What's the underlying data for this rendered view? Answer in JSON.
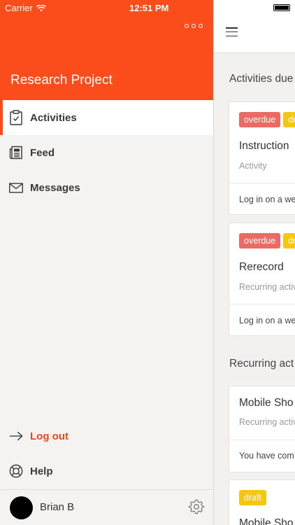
{
  "status_bar": {
    "carrier": "Carrier",
    "time": "12:51 PM"
  },
  "drawer": {
    "title": "Research Project",
    "nav": [
      {
        "label": "Activities",
        "icon": "clipboard-check-icon",
        "active": true
      },
      {
        "label": "Feed",
        "icon": "newspaper-icon",
        "active": false
      },
      {
        "label": "Messages",
        "icon": "envelope-icon",
        "active": false
      }
    ],
    "logout_label": "Log out",
    "help_label": "Help",
    "user_name": "Brian B"
  },
  "main": {
    "section_due": "Activities due",
    "section_recurring": "Recurring act",
    "cards": [
      {
        "badges": [
          "overdue",
          "dr"
        ],
        "title": "Instruction",
        "subtitle": "Activity",
        "note": "Log in on a we"
      },
      {
        "badges": [
          "overdue",
          "dr"
        ],
        "title": "Rerecord",
        "subtitle": "Recurring activ",
        "note": "Log in on a we"
      },
      {
        "badges": [],
        "title": "Mobile Sho",
        "subtitle": "Recurring activ",
        "note": "You have com"
      },
      {
        "badges": [
          "draft"
        ],
        "title": "Mobile Sho",
        "subtitle": "",
        "note": ""
      }
    ]
  },
  "colors": {
    "accent": "#fb4d1b",
    "overdue": "#ea6a64",
    "draft": "#f5c710"
  }
}
